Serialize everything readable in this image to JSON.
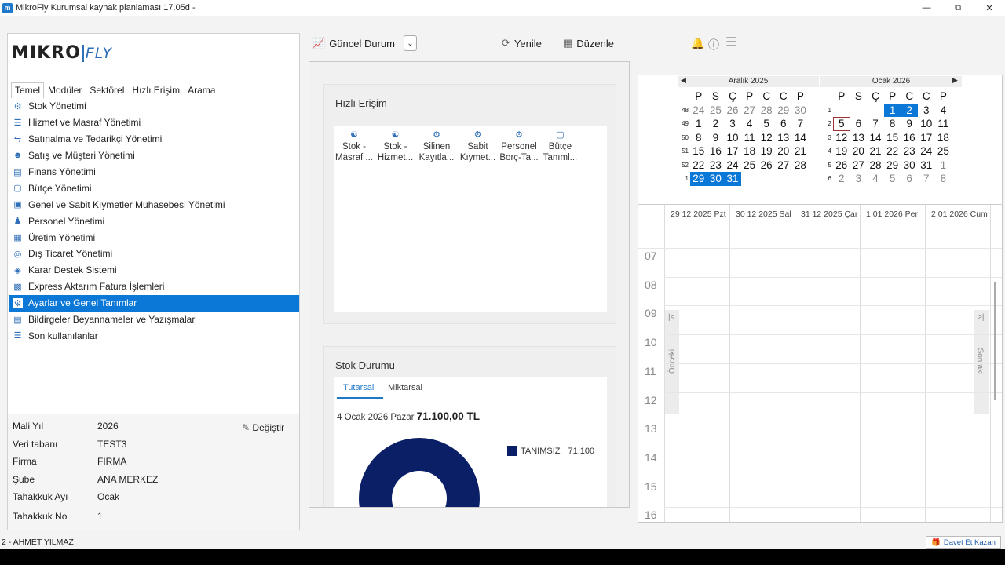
{
  "window": {
    "title": "MikroFly Kurumsal kaynak planlaması 17.05d -",
    "app_icon": "m"
  },
  "logo": {
    "main": "MIKRO",
    "sub": "FLY"
  },
  "tabs": [
    "Temel",
    "Modüler",
    "Sektörel",
    "Hızlı Erişim",
    "Arama"
  ],
  "menu": [
    {
      "label": "Stok Yönetimi",
      "icon": "stock-icon"
    },
    {
      "label": "Hizmet ve Masraf Yönetimi",
      "icon": "service-icon"
    },
    {
      "label": "Satınalma ve Tedarikçi Yönetimi",
      "icon": "purchase-icon"
    },
    {
      "label": "Satış ve Müşteri Yönetimi",
      "icon": "sales-icon"
    },
    {
      "label": "Finans Yönetimi",
      "icon": "finance-icon"
    },
    {
      "label": "Bütçe Yönetimi",
      "icon": "budget-icon"
    },
    {
      "label": "Genel ve Sabit Kıymetler Muhasebesi Yönetimi",
      "icon": "accounting-icon"
    },
    {
      "label": "Personel Yönetimi",
      "icon": "personnel-icon"
    },
    {
      "label": "Üretim Yönetimi",
      "icon": "factory-icon"
    },
    {
      "label": "Dış Ticaret Yönetimi",
      "icon": "globe-icon"
    },
    {
      "label": "Karar Destek Sistemi",
      "icon": "decision-icon"
    },
    {
      "label": "Express Aktarım Fatura İşlemleri",
      "icon": "invoice-icon"
    },
    {
      "label": "Ayarlar ve Genel Tanımlar",
      "icon": "gear-icon"
    },
    {
      "label": "Bildirgeler Beyannameler ve Yazışmalar",
      "icon": "document-icon"
    },
    {
      "label": "Son kullanılanlar",
      "icon": "list-icon"
    }
  ],
  "menu_selected_index": 12,
  "info": {
    "rows": [
      {
        "key": "Mali Yıl",
        "value": "2026"
      },
      {
        "key": "Veri tabanı",
        "value": "TEST3"
      },
      {
        "key": "Firma",
        "value": "FIRMA"
      },
      {
        "key": "Şube",
        "value": "ANA MERKEZ"
      },
      {
        "key": "Tahakkuk Ayı",
        "value": "Ocak"
      },
      {
        "key": "Tahakkuk No",
        "value": "1"
      }
    ],
    "change_label": "Değiştir"
  },
  "toolbar": {
    "status_label": "Güncel Durum",
    "refresh_label": "Yenile",
    "edit_label": "Düzenle"
  },
  "quick_access": {
    "title": "Hızlı Erişim",
    "items": [
      {
        "l1": "Stok -",
        "l2": "Masraf ..."
      },
      {
        "l1": "Stok -",
        "l2": "Hizmet..."
      },
      {
        "l1": "Silinen",
        "l2": "Kayıtla..."
      },
      {
        "l1": "Sabit",
        "l2": "Kıymet..."
      },
      {
        "l1": "Personel",
        "l2": "Borç-Ta..."
      },
      {
        "l1": "Bütçe",
        "l2": "Tanıml..."
      }
    ]
  },
  "stock": {
    "title": "Stok Durumu",
    "tab1": "Tutarsal",
    "tab2": "Miktarsal",
    "date": "4 Ocak 2026 Pazar",
    "total": "71.100,00 TL",
    "legend_label": "TANIMSIZ",
    "legend_value": "71.100",
    "color": "#0a1f66"
  },
  "calendar": {
    "left": {
      "title": "Aralık 2025"
    },
    "right": {
      "title": "Ocak 2026"
    },
    "day_headers": [
      "P",
      "S",
      "Ç",
      "P",
      "C",
      "C",
      "P"
    ],
    "left_weeks": [
      "48",
      "49",
      "50",
      "51",
      "52",
      "1"
    ],
    "right_weeks": [
      "1",
      "2",
      "3",
      "4",
      "5",
      "6"
    ],
    "left_days": [
      [
        "24",
        "25",
        "26",
        "27",
        "28",
        "29",
        "30"
      ],
      [
        "1",
        "2",
        "3",
        "4",
        "5",
        "6",
        "7"
      ],
      [
        "8",
        "9",
        "10",
        "11",
        "12",
        "13",
        "14"
      ],
      [
        "15",
        "16",
        "17",
        "18",
        "19",
        "20",
        "21"
      ],
      [
        "22",
        "23",
        "24",
        "25",
        "26",
        "27",
        "28"
      ],
      [
        "29",
        "30",
        "31",
        "",
        "",
        "",
        ""
      ]
    ],
    "right_days": [
      [
        "",
        "",
        "",
        "1",
        "2",
        "3",
        "4"
      ],
      [
        "5",
        "6",
        "7",
        "8",
        "9",
        "10",
        "11"
      ],
      [
        "12",
        "13",
        "14",
        "15",
        "16",
        "17",
        "18"
      ],
      [
        "19",
        "20",
        "21",
        "22",
        "23",
        "24",
        "25"
      ],
      [
        "26",
        "27",
        "28",
        "29",
        "30",
        "31",
        "1"
      ],
      [
        "2",
        "3",
        "4",
        "5",
        "6",
        "7",
        "8"
      ]
    ]
  },
  "schedule": {
    "columns": [
      "29 12 2025 Pzt",
      "30 12 2025 Sal",
      "31 12 2025 Çar",
      "1 01 2026 Per",
      "2 01 2026 Cum"
    ],
    "hours": [
      "07",
      "08",
      "09",
      "10",
      "11",
      "12",
      "13",
      "14",
      "15",
      "16"
    ],
    "prev_label": "Önceki",
    "next_label": "Sonraki"
  },
  "status": {
    "user": "2 - AHMET YILMAZ",
    "invite_label": "Davet Et Kazan"
  }
}
